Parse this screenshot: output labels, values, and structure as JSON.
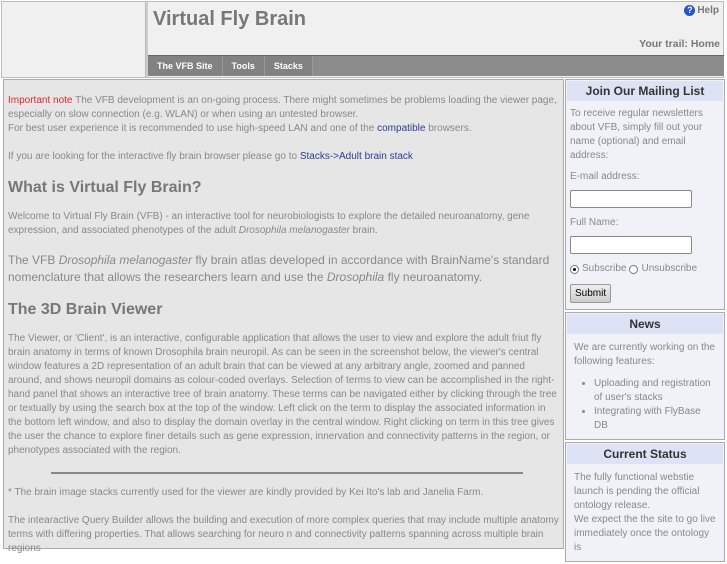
{
  "header": {
    "title": "Virtual Fly Brain",
    "help": "Help",
    "trail": "Your trail: Home"
  },
  "nav": [
    "The VFB Site",
    "Tools",
    "Stacks"
  ],
  "main": {
    "note_label": "Important note",
    "note_text": " The VFB development is an on-going process. There might sometimes be problems loading the viewer page, especially on slow connection (e.g. WLAN) or when using an untested browser.",
    "best_pre": "For best user experience it is recommended to use high-speed LAN and one of the ",
    "best_link": "compatible",
    "best_post": " browsers.",
    "looking_pre": "If you are looking for the interactive fly brain browser please go to ",
    "looking_link": "Stacks->Adult brain stack",
    "h1": "What is Virtual Fly Brain?",
    "welcome_pre": "Welcome to Virtual Fly Brain (VFB) - an interactive tool for neurobiologists to explore the detailed neuroanatomy, gene expression, and associated phenotypes of the adult ",
    "welcome_em": "Drosophila melanogaster",
    "welcome_post": " brain.",
    "atlas_1": "The VFB ",
    "atlas_em1": "Drosophila melanogaster",
    "atlas_2": " fly brain atlas developed in accordance with BrainName's standard nomenclature that allows the researchers learn and use the ",
    "atlas_em2": "Drosophila",
    "atlas_3": " fly neuroanatomy.",
    "h2": "The 3D Brain Viewer",
    "viewer": "The Viewer, or 'Client', is an interactive, configurable application that allows the user to view and explore the adult friut fly brain anatomy in terms of known Drosophila brain neuropil. As can be seen in the screenshot below, the viewer's central window features a 2D representation of an adult brain that can be viewed at any arbitrary angle, zoomed and panned around, and shows neuropil domains as colour-coded overlays. Selection of terms to view can be accomplished in the right-hand panel that shows an interactive tree of brain anatomy. These terms can be navigated either by clicking through the tree or textually by using the search box at the top of the window. Left click on the term to display the associated information in the bottom left window, and also to display the domain overlay in the central window. Right clicking on term in this tree gives the user the chance to explore finer details such as gene expression, innervation and connectivity patterns in the region, or phenotypes associated with the region.",
    "stacks_note": "* The brain image stacks currently used for the viewer are kindly provided by Kei Ito's lab and Janelia Farm.",
    "query": "The intearactive Query Builder allows the building and execution of more complex queries that may include multiple anatomy terms with differing properties. That allows searching for neuro n and connectivity patterns spanning across multiple brain regions"
  },
  "sidebar": {
    "mailing": {
      "title": "Join Our Mailing List",
      "intro": "To receive regular newsletters about VFB, simply fill out your name (optional) and email address:",
      "email_label": "E-mail address:",
      "email_value": "",
      "name_label": "Full Name:",
      "name_value": "",
      "subscribe": "Subscribe",
      "unsubscribe": "Unsubscribe",
      "submit": "Submit"
    },
    "news": {
      "title": "News",
      "intro": "We are currently working on the following features:",
      "items": [
        "Uploading and registration of user's stacks",
        "Integrating with FlyBase DB"
      ]
    },
    "status": {
      "title": "Current Status",
      "text1": "The fully functional webstie launch is pending the official ontology release.",
      "text2": "We expect the the site to go live immediately once the ontology is"
    }
  }
}
